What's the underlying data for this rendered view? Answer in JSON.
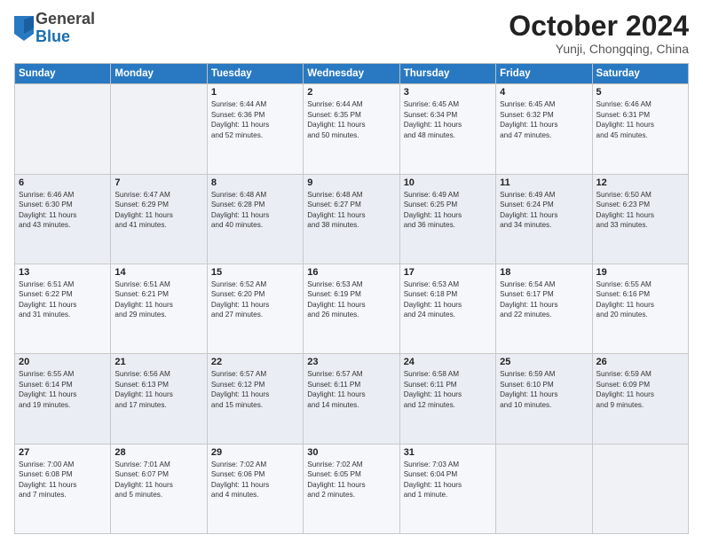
{
  "header": {
    "logo_general": "General",
    "logo_blue": "Blue",
    "month_title": "October 2024",
    "location": "Yunji, Chongqing, China"
  },
  "days_of_week": [
    "Sunday",
    "Monday",
    "Tuesday",
    "Wednesday",
    "Thursday",
    "Friday",
    "Saturday"
  ],
  "weeks": [
    [
      {
        "day": "",
        "content": ""
      },
      {
        "day": "",
        "content": ""
      },
      {
        "day": "1",
        "content": "Sunrise: 6:44 AM\nSunset: 6:36 PM\nDaylight: 11 hours\nand 52 minutes."
      },
      {
        "day": "2",
        "content": "Sunrise: 6:44 AM\nSunset: 6:35 PM\nDaylight: 11 hours\nand 50 minutes."
      },
      {
        "day": "3",
        "content": "Sunrise: 6:45 AM\nSunset: 6:34 PM\nDaylight: 11 hours\nand 48 minutes."
      },
      {
        "day": "4",
        "content": "Sunrise: 6:45 AM\nSunset: 6:32 PM\nDaylight: 11 hours\nand 47 minutes."
      },
      {
        "day": "5",
        "content": "Sunrise: 6:46 AM\nSunset: 6:31 PM\nDaylight: 11 hours\nand 45 minutes."
      }
    ],
    [
      {
        "day": "6",
        "content": "Sunrise: 6:46 AM\nSunset: 6:30 PM\nDaylight: 11 hours\nand 43 minutes."
      },
      {
        "day": "7",
        "content": "Sunrise: 6:47 AM\nSunset: 6:29 PM\nDaylight: 11 hours\nand 41 minutes."
      },
      {
        "day": "8",
        "content": "Sunrise: 6:48 AM\nSunset: 6:28 PM\nDaylight: 11 hours\nand 40 minutes."
      },
      {
        "day": "9",
        "content": "Sunrise: 6:48 AM\nSunset: 6:27 PM\nDaylight: 11 hours\nand 38 minutes."
      },
      {
        "day": "10",
        "content": "Sunrise: 6:49 AM\nSunset: 6:25 PM\nDaylight: 11 hours\nand 36 minutes."
      },
      {
        "day": "11",
        "content": "Sunrise: 6:49 AM\nSunset: 6:24 PM\nDaylight: 11 hours\nand 34 minutes."
      },
      {
        "day": "12",
        "content": "Sunrise: 6:50 AM\nSunset: 6:23 PM\nDaylight: 11 hours\nand 33 minutes."
      }
    ],
    [
      {
        "day": "13",
        "content": "Sunrise: 6:51 AM\nSunset: 6:22 PM\nDaylight: 11 hours\nand 31 minutes."
      },
      {
        "day": "14",
        "content": "Sunrise: 6:51 AM\nSunset: 6:21 PM\nDaylight: 11 hours\nand 29 minutes."
      },
      {
        "day": "15",
        "content": "Sunrise: 6:52 AM\nSunset: 6:20 PM\nDaylight: 11 hours\nand 27 minutes."
      },
      {
        "day": "16",
        "content": "Sunrise: 6:53 AM\nSunset: 6:19 PM\nDaylight: 11 hours\nand 26 minutes."
      },
      {
        "day": "17",
        "content": "Sunrise: 6:53 AM\nSunset: 6:18 PM\nDaylight: 11 hours\nand 24 minutes."
      },
      {
        "day": "18",
        "content": "Sunrise: 6:54 AM\nSunset: 6:17 PM\nDaylight: 11 hours\nand 22 minutes."
      },
      {
        "day": "19",
        "content": "Sunrise: 6:55 AM\nSunset: 6:16 PM\nDaylight: 11 hours\nand 20 minutes."
      }
    ],
    [
      {
        "day": "20",
        "content": "Sunrise: 6:55 AM\nSunset: 6:14 PM\nDaylight: 11 hours\nand 19 minutes."
      },
      {
        "day": "21",
        "content": "Sunrise: 6:56 AM\nSunset: 6:13 PM\nDaylight: 11 hours\nand 17 minutes."
      },
      {
        "day": "22",
        "content": "Sunrise: 6:57 AM\nSunset: 6:12 PM\nDaylight: 11 hours\nand 15 minutes."
      },
      {
        "day": "23",
        "content": "Sunrise: 6:57 AM\nSunset: 6:11 PM\nDaylight: 11 hours\nand 14 minutes."
      },
      {
        "day": "24",
        "content": "Sunrise: 6:58 AM\nSunset: 6:11 PM\nDaylight: 11 hours\nand 12 minutes."
      },
      {
        "day": "25",
        "content": "Sunrise: 6:59 AM\nSunset: 6:10 PM\nDaylight: 11 hours\nand 10 minutes."
      },
      {
        "day": "26",
        "content": "Sunrise: 6:59 AM\nSunset: 6:09 PM\nDaylight: 11 hours\nand 9 minutes."
      }
    ],
    [
      {
        "day": "27",
        "content": "Sunrise: 7:00 AM\nSunset: 6:08 PM\nDaylight: 11 hours\nand 7 minutes."
      },
      {
        "day": "28",
        "content": "Sunrise: 7:01 AM\nSunset: 6:07 PM\nDaylight: 11 hours\nand 5 minutes."
      },
      {
        "day": "29",
        "content": "Sunrise: 7:02 AM\nSunset: 6:06 PM\nDaylight: 11 hours\nand 4 minutes."
      },
      {
        "day": "30",
        "content": "Sunrise: 7:02 AM\nSunset: 6:05 PM\nDaylight: 11 hours\nand 2 minutes."
      },
      {
        "day": "31",
        "content": "Sunrise: 7:03 AM\nSunset: 6:04 PM\nDaylight: 11 hours\nand 1 minute."
      },
      {
        "day": "",
        "content": ""
      },
      {
        "day": "",
        "content": ""
      }
    ]
  ]
}
